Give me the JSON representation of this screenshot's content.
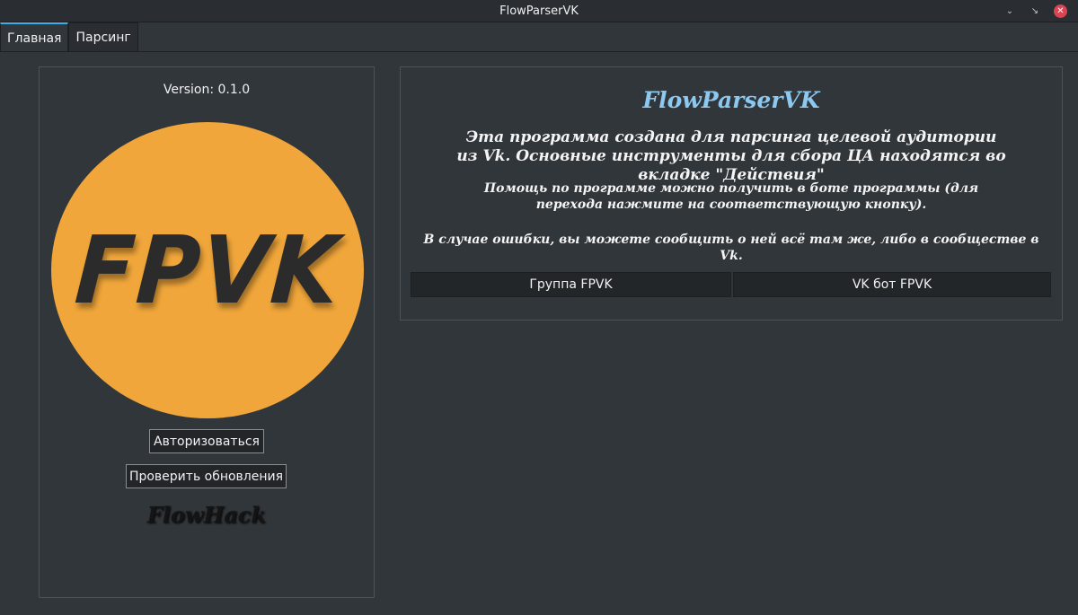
{
  "window": {
    "title": "FlowParserVK",
    "buttons": [
      "minimize-icon",
      "maximize-icon",
      "close-icon"
    ]
  },
  "tabs": [
    {
      "label": "Главная",
      "active": true
    },
    {
      "label": "Парсинг",
      "active": false
    }
  ],
  "left_panel": {
    "version": "Version: 0.1.0",
    "logo_text": "FPVK",
    "auth_button": "Авторизоваться",
    "update_button": "Проверить обновления",
    "brand": "FlowHack"
  },
  "right_panel": {
    "app_title": "FlowParserVK",
    "description": "Эта программа создана для парсинга целевой аудитории из Vk. Основные инструменты для сбора ЦА находятся во вкладке \"Действия\"",
    "help_text": "Помощь по программе можно получить в боте программы (для перехода нажмите на соответствующую кнопку).",
    "error_text": "В случае ошибки, вы можете сообщить о ней всё там же, либо в сообществе в Vk.",
    "group_button": "Группа FPVK",
    "bot_button": "VK бот FPVK"
  },
  "colors": {
    "background": "#31363b",
    "accent": "#3daee9",
    "title_color": "#8cc8ef",
    "logo_circle": "#f0a63a",
    "close_button": "#da4453"
  }
}
